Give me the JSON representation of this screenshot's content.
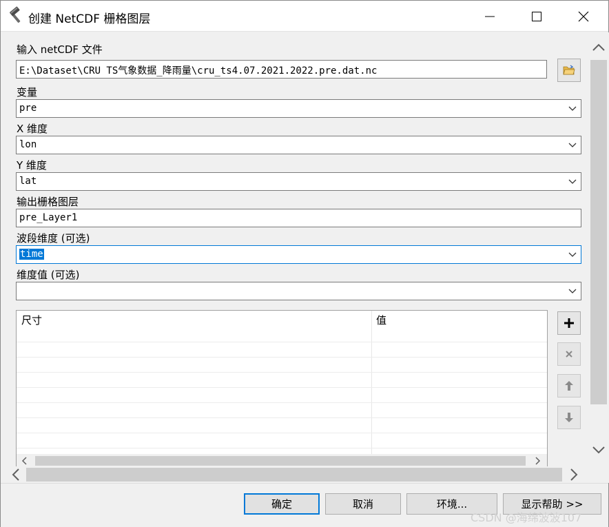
{
  "window": {
    "title": "创建 NetCDF 栅格图层",
    "title_icon": "hammer-icon"
  },
  "form": {
    "input_label": "输入 netCDF 文件",
    "input_value": "E:\\Dataset\\CRU TS气象数据_降雨量\\cru_ts4.07.2021.2022.pre.dat.nc",
    "variable_label": "变量",
    "variable_value": "pre",
    "x_label": "X 维度",
    "x_value": "lon",
    "y_label": "Y 维度",
    "y_value": "lat",
    "output_label": "输出栅格图层",
    "output_value": "pre_Layer1",
    "band_label": "波段维度 (可选)",
    "band_value": "time",
    "dimval_label": "维度值 (可选)",
    "dimval_value": ""
  },
  "table": {
    "columns": [
      "尺寸",
      "值"
    ],
    "rows": []
  },
  "footer": {
    "ok": "确定",
    "cancel": "取消",
    "env": "环境...",
    "help": "显示帮助 >>"
  },
  "watermark": "CSDN @海绵波波107",
  "colors": {
    "selection": "#0078d7",
    "default_button_border": "#0078d7"
  }
}
